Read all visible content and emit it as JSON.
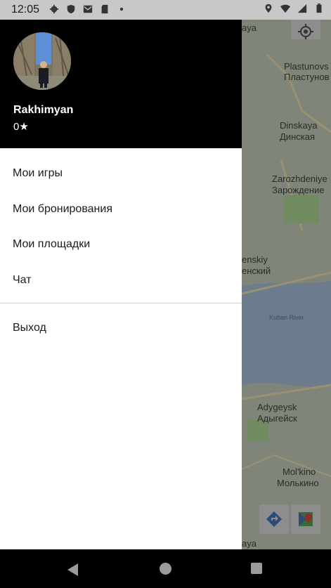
{
  "status_bar": {
    "time": "12:05",
    "icons": [
      "gear-icon",
      "shield-icon",
      "mail-icon",
      "sd-card-icon",
      "dot-icon",
      "location-icon",
      "wifi-icon",
      "battery-icon"
    ]
  },
  "map": {
    "labels": [
      "Plastunovs",
      "Пластунов",
      "Dinskaya",
      "Динская",
      "Zarozhdeniye",
      "Зарождение",
      "enskiy",
      "енский",
      "Kuban River",
      "Adygeysk",
      "Адыгейск",
      "Mol'kino",
      "Молькино",
      "aya",
      "aya"
    ],
    "water_color": "#6d7c8c",
    "road_color": "#9a9172"
  },
  "drawer": {
    "user_name": "Rakhimyan",
    "rating": "0★",
    "menu": [
      "Мои игры",
      "Мои бронирования",
      "Мои площадки",
      "Чат"
    ],
    "logout": "Выход"
  },
  "nav_bar": {
    "buttons": [
      "back-icon",
      "home-icon",
      "recent-apps-icon"
    ]
  }
}
